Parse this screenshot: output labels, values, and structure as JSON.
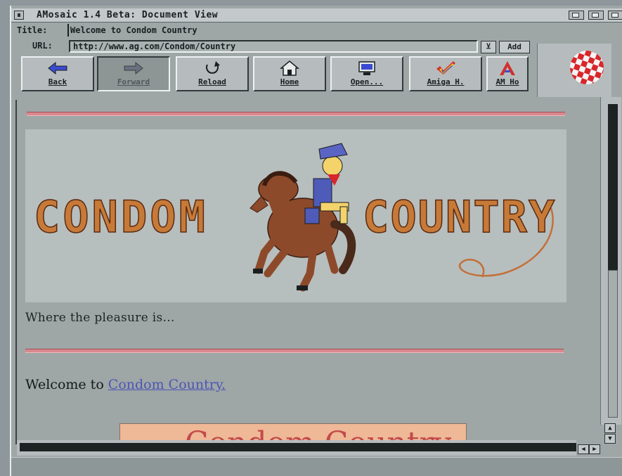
{
  "window": {
    "title": "AMosaic 1.4 Beta: Document View"
  },
  "page_title": {
    "label": "Title:",
    "value": "Welcome to Condom Country"
  },
  "url_bar": {
    "label": "URL:",
    "value": "http://www.ag.com/Condom/Country",
    "dropdown_glyph": "⊻",
    "add_label": "Add"
  },
  "toolbar": {
    "buttons": [
      {
        "label": "Back",
        "icon": "back-arrow-icon"
      },
      {
        "label": "Forward",
        "icon": "forward-arrow-icon",
        "state": "pressed"
      },
      {
        "label": "Reload",
        "icon": "reload-icon"
      },
      {
        "label": "Home",
        "icon": "home-icon"
      },
      {
        "label": "Open...",
        "icon": "open-icon"
      },
      {
        "label": "Amiga H.",
        "icon": "amiga-checkmark-icon"
      },
      {
        "label": "AM Ho",
        "icon": "amiga-logo-icon"
      }
    ]
  },
  "logo": {
    "icon": "boing-ball-icon"
  },
  "content": {
    "banner": {
      "left_word": "CONDOM",
      "right_word": "COUNTRY",
      "image": "cowboy-on-horse-illustration"
    },
    "tagline": "Where the pleasure is...",
    "welcome_text": "Welcome to ",
    "welcome_link": "Condom Country.",
    "bottom_box_text": "Condom Country"
  },
  "colors": {
    "background": "#9ea6a6",
    "rule": "#d9888e",
    "link": "#4d56b5",
    "banner_bg": "#b7bebe",
    "bottom_box": "#efb897"
  }
}
